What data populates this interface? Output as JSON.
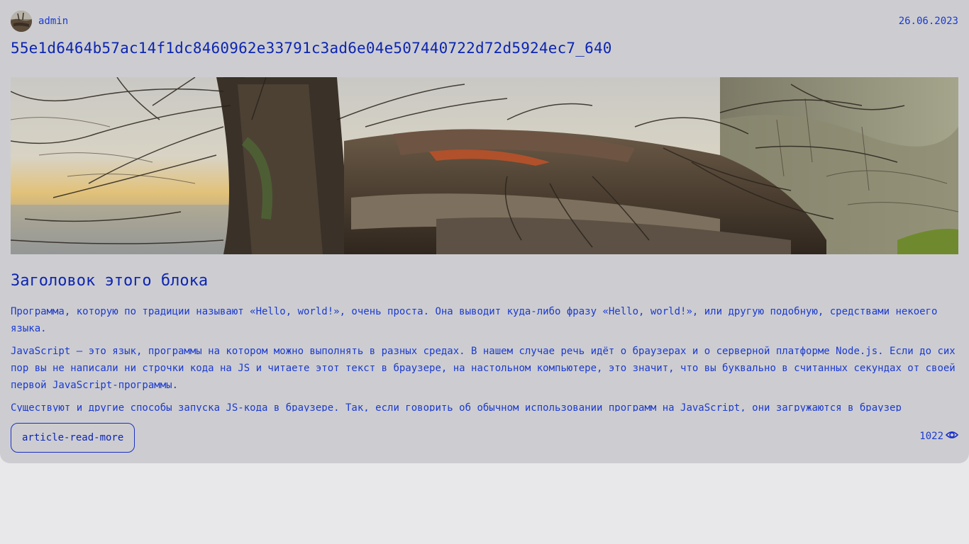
{
  "header": {
    "author_name": "admin",
    "date": "26.06.2023"
  },
  "article": {
    "title": "55e1d6464b57ac14f1dc8460962e33791c3ad6e04e507440722d72d5924ec7_640",
    "block_heading": "Заголовок этого блока",
    "paragraphs": [
      "Программа, которую по традиции называют «Hello, world!», очень проста. Она выводит куда-либо фразу «Hello, world!», или другую подобную, средствами некоего языка.",
      "JavaScript — это язык, программы на котором можно выполнять в разных средах. В нашем случае речь идёт о браузерах и о серверной платформе Node.js. Если до сих пор вы не написали ни строчки кода на JS и читаете этот текст в браузере, на настольном компьютере, это значит, что вы буквально в считанных секундах от своей первой JavaScript-программы.",
      "Существуют и другие способы запуска JS-кода в браузере. Так, если говорить об обычном использовании программ на JavaScript, они загружаются в браузер"
    ],
    "read_more_label": "article-read-more",
    "views_count": "1022"
  },
  "icons": {
    "views": "eye-icon",
    "avatar": "user-avatar"
  },
  "colors": {
    "accent": "#1b2fc9",
    "card_background": "#cdcdd1",
    "page_background": "#e8e8ea"
  }
}
